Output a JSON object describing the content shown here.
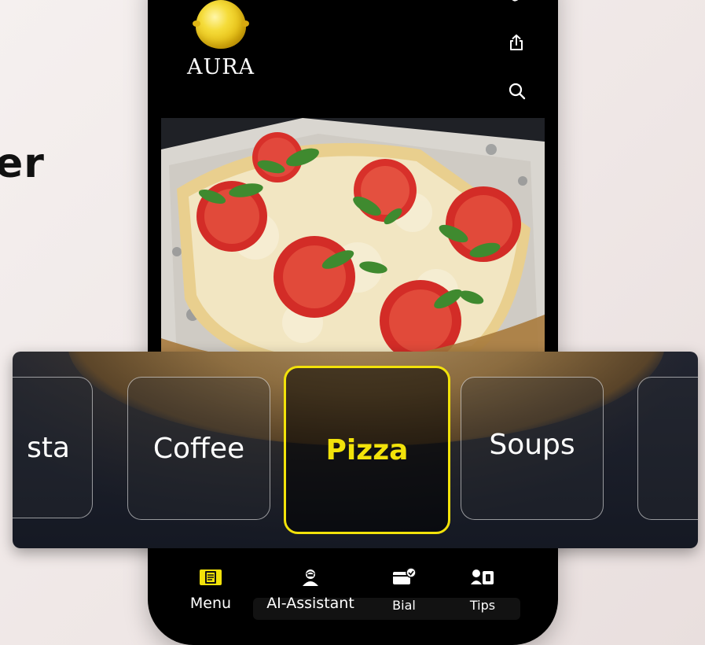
{
  "page": {
    "background_heading": "er"
  },
  "header": {
    "brand_name": "AURA",
    "icons": [
      "more-icon",
      "share-icon",
      "search-icon"
    ]
  },
  "categories": {
    "items": [
      {
        "label": "sta",
        "active": false
      },
      {
        "label": "Coffee",
        "active": false
      },
      {
        "label": "Pizza",
        "active": true
      },
      {
        "label": "Soups",
        "active": false
      },
      {
        "label": "",
        "active": false
      }
    ],
    "active_color": "#f2e20a"
  },
  "bottom_nav": {
    "items": [
      {
        "label": "Menu",
        "icon": "menu-book-icon",
        "active": true
      },
      {
        "label": "AI-Assistant",
        "icon": "assistant-icon",
        "active": false
      },
      {
        "label": "Bial",
        "icon": "bill-icon",
        "active": false
      },
      {
        "label": "Tips",
        "icon": "tips-icon",
        "active": false
      }
    ],
    "active_color": "#f2e20a"
  }
}
